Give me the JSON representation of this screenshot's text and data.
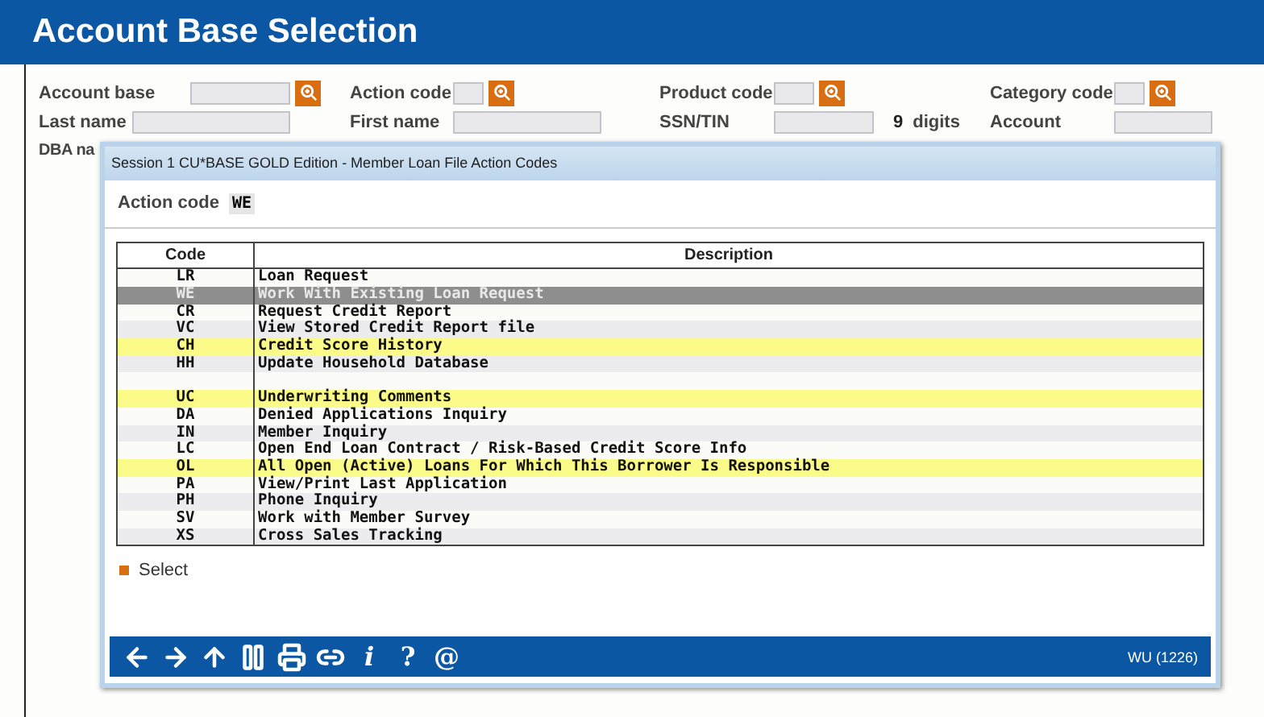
{
  "header": {
    "title": "Account Base Selection"
  },
  "form": {
    "rows": [
      {
        "fields": [
          {
            "kind": "lookup",
            "label": "Account base"
          },
          {
            "kind": "lookup",
            "label": "Action code"
          },
          {
            "kind": "lookup",
            "label": "Product code"
          },
          {
            "kind": "lookup",
            "label": "Category code"
          }
        ]
      },
      {
        "fields": [
          {
            "kind": "plain",
            "label": "Last name"
          },
          {
            "kind": "plain",
            "label": "First name"
          },
          {
            "kind": "plain",
            "label": "SSN/TIN",
            "suffix_value": "9",
            "suffix": "digits"
          },
          {
            "kind": "plain",
            "label": "Account"
          }
        ]
      }
    ],
    "partial_label": "DBA na"
  },
  "dialog": {
    "title": "Session 1 CU*BASE GOLD Edition - Member Loan File Action Codes",
    "action_label": "Action code",
    "action_value": "WE",
    "table": {
      "columns": [
        "Code",
        "Description"
      ],
      "rows": [
        {
          "kind": "entry",
          "code": "LR",
          "description": "Loan Request",
          "selected": false,
          "highlighted": false
        },
        {
          "kind": "entry",
          "code": "WE",
          "description": "Work With Existing Loan Request",
          "selected": true,
          "highlighted": false
        },
        {
          "kind": "entry",
          "code": "CR",
          "description": "Request Credit Report",
          "selected": false,
          "highlighted": false
        },
        {
          "kind": "entry",
          "code": "VC",
          "description": "View Stored Credit Report file",
          "selected": false,
          "highlighted": false
        },
        {
          "kind": "entry",
          "code": "CH",
          "description": "Credit Score History",
          "selected": false,
          "highlighted": true
        },
        {
          "kind": "entry",
          "code": "HH",
          "description": "Update Household Database",
          "selected": false,
          "highlighted": false
        },
        {
          "kind": "blank"
        },
        {
          "kind": "entry",
          "code": "UC",
          "description": "Underwriting Comments",
          "selected": false,
          "highlighted": true
        },
        {
          "kind": "entry",
          "code": "DA",
          "description": "Denied Applications Inquiry",
          "selected": false,
          "highlighted": false
        },
        {
          "kind": "entry",
          "code": "IN",
          "description": "Member Inquiry",
          "selected": false,
          "highlighted": false
        },
        {
          "kind": "entry",
          "code": "LC",
          "description": "Open End Loan Contract / Risk-Based Credit Score Info",
          "selected": false,
          "highlighted": false
        },
        {
          "kind": "entry",
          "code": "OL",
          "description": "All Open (Active) Loans For Which This Borrower Is Responsible",
          "selected": false,
          "highlighted": true
        },
        {
          "kind": "entry",
          "code": "PA",
          "description": "View/Print Last Application",
          "selected": false,
          "highlighted": false
        },
        {
          "kind": "entry",
          "code": "PH",
          "description": "Phone Inquiry",
          "selected": false,
          "highlighted": false
        },
        {
          "kind": "entry",
          "code": "SV",
          "description": "Work with Member Survey",
          "selected": false,
          "highlighted": false
        },
        {
          "kind": "entry",
          "code": "XS",
          "description": "Cross Sales Tracking",
          "selected": false,
          "highlighted": false
        }
      ]
    },
    "actions": [
      "Select"
    ],
    "toolbar_glyphs": [
      "i",
      "?",
      "@"
    ],
    "status": "WU (1226)"
  }
}
